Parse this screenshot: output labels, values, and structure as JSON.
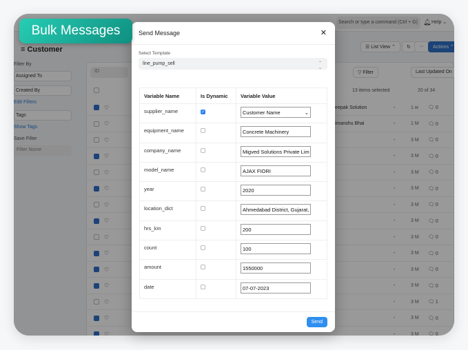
{
  "badge": "Bulk Messages",
  "app": {
    "search_placeholder": "Search or type a command (Ctrl + G)",
    "help": "Help ⌄",
    "page_title": "Customer",
    "list_view": "☰ List View ⌃",
    "actions": "Actions ⌃",
    "filter_by": "Filter By",
    "assigned_to": "Assigned To",
    "created_by": "Created By",
    "edit_filters": "Edit Filters",
    "tags": "Tags",
    "show_tags": "Show Tags",
    "save_filter": "Save Filter",
    "filter_name_placeholder": "Filter Name",
    "id_placeholder": "ID",
    "filter": "Filter",
    "sort": "Last Updated On",
    "selected": "13 items selected",
    "count": "20 of 34",
    "rows": [
      {
        "checked": true,
        "name": "Deepak Solution",
        "time": "1 w",
        "comments": "0"
      },
      {
        "checked": false,
        "name": "Himanshu Bhai",
        "time": "1 M",
        "comments": "0"
      },
      {
        "checked": false,
        "name": "",
        "time": "3 M",
        "comments": "0"
      },
      {
        "checked": true,
        "name": "",
        "time": "3 M",
        "comments": "0"
      },
      {
        "checked": false,
        "name": "",
        "time": "3 M",
        "comments": "0"
      },
      {
        "checked": true,
        "name": "",
        "time": "3 M",
        "comments": "0"
      },
      {
        "checked": false,
        "name": "",
        "time": "3 M",
        "comments": "0"
      },
      {
        "checked": true,
        "name": "",
        "time": "3 M",
        "comments": "0"
      },
      {
        "checked": false,
        "name": "",
        "time": "3 M",
        "comments": "0"
      },
      {
        "checked": true,
        "name": "",
        "time": "3 M",
        "comments": "0"
      },
      {
        "checked": true,
        "name": "",
        "time": "3 M",
        "comments": "0"
      },
      {
        "checked": true,
        "name": "",
        "time": "3 M",
        "comments": "0"
      },
      {
        "checked": false,
        "name": "",
        "time": "3 M",
        "comments": "1"
      },
      {
        "checked": true,
        "name": "",
        "time": "3 M",
        "comments": "0"
      },
      {
        "checked": true,
        "name": "",
        "time": "3 M",
        "comments": "0"
      }
    ]
  },
  "modal": {
    "title": "Send Message",
    "template_label": "Select Template",
    "template_value": "line_pump_sell",
    "headers": [
      "Variable Name",
      "Is Dynamic",
      "Variable Value"
    ],
    "rows": [
      {
        "name": "supplier_name",
        "dynamic": true,
        "value": "Customer Name"
      },
      {
        "name": "equipment_name",
        "dynamic": false,
        "value": "Concrete Machinery"
      },
      {
        "name": "company_name",
        "dynamic": false,
        "value": "Migved Solutions Private Lim"
      },
      {
        "name": "model_name",
        "dynamic": false,
        "value": "AJAX FIORI"
      },
      {
        "name": "year",
        "dynamic": false,
        "value": "2020"
      },
      {
        "name": "location_dict",
        "dynamic": false,
        "value": "Ahmedabad District, Gujarat,"
      },
      {
        "name": "hrs_km",
        "dynamic": false,
        "value": "200"
      },
      {
        "name": "count",
        "dynamic": false,
        "value": "100"
      },
      {
        "name": "amount",
        "dynamic": false,
        "value": "1550000"
      },
      {
        "name": "date",
        "dynamic": false,
        "value": "07-07-2023"
      }
    ],
    "send": "Send"
  }
}
